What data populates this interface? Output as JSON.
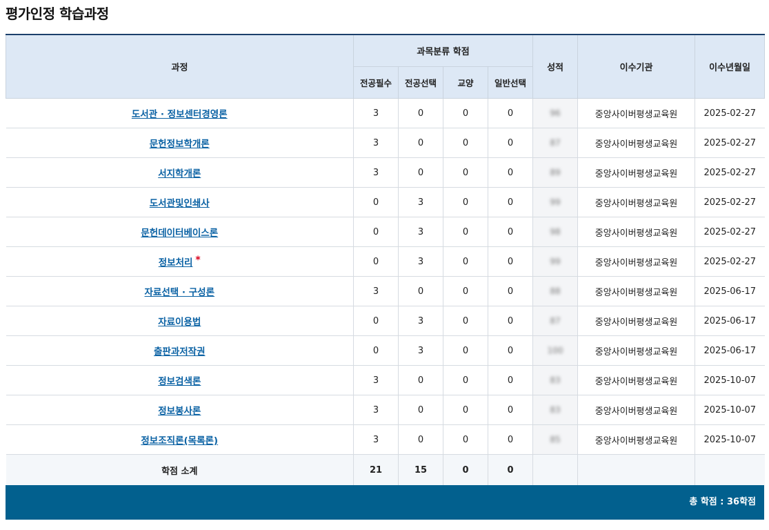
{
  "page_title": "평가인정 학습과정",
  "headers": {
    "course": "과정",
    "category_group": "과목분류 학점",
    "major_required": "전공필수",
    "major_elective": "전공선택",
    "liberal_arts": "교양",
    "general_elective": "일반선택",
    "grade": "성적",
    "institution": "이수기관",
    "completion_date": "이수년월일"
  },
  "rows": [
    {
      "course": "도서관 · 정보센터경영론",
      "mr": "3",
      "me": "0",
      "la": "0",
      "ge": "0",
      "grade": "96",
      "inst": "중앙사이버평생교육원",
      "date": "2025-02-27",
      "star": ""
    },
    {
      "course": "문헌정보학개론",
      "mr": "3",
      "me": "0",
      "la": "0",
      "ge": "0",
      "grade": "87",
      "inst": "중앙사이버평생교육원",
      "date": "2025-02-27",
      "star": ""
    },
    {
      "course": "서지학개론",
      "mr": "3",
      "me": "0",
      "la": "0",
      "ge": "0",
      "grade": "89",
      "inst": "중앙사이버평생교육원",
      "date": "2025-02-27",
      "star": ""
    },
    {
      "course": "도서관및인쇄사",
      "mr": "0",
      "me": "3",
      "la": "0",
      "ge": "0",
      "grade": "99",
      "inst": "중앙사이버평생교육원",
      "date": "2025-02-27",
      "star": ""
    },
    {
      "course": "문헌데이터베이스론",
      "mr": "0",
      "me": "3",
      "la": "0",
      "ge": "0",
      "grade": "98",
      "inst": "중앙사이버평생교육원",
      "date": "2025-02-27",
      "star": ""
    },
    {
      "course": "정보처리",
      "mr": "0",
      "me": "3",
      "la": "0",
      "ge": "0",
      "grade": "99",
      "inst": "중앙사이버평생교육원",
      "date": "2025-02-27",
      "star": "*"
    },
    {
      "course": "자료선택 · 구성론",
      "mr": "3",
      "me": "0",
      "la": "0",
      "ge": "0",
      "grade": "88",
      "inst": "중앙사이버평생교육원",
      "date": "2025-06-17",
      "star": ""
    },
    {
      "course": "자료이용법",
      "mr": "0",
      "me": "3",
      "la": "0",
      "ge": "0",
      "grade": "87",
      "inst": "중앙사이버평생교육원",
      "date": "2025-06-17",
      "star": ""
    },
    {
      "course": "출판과저작권",
      "mr": "0",
      "me": "3",
      "la": "0",
      "ge": "0",
      "grade": "100",
      "inst": "중앙사이버평생교육원",
      "date": "2025-06-17",
      "star": ""
    },
    {
      "course": "정보검색론",
      "mr": "3",
      "me": "0",
      "la": "0",
      "ge": "0",
      "grade": "83",
      "inst": "중앙사이버평생교육원",
      "date": "2025-10-07",
      "star": ""
    },
    {
      "course": "정보봉사론",
      "mr": "3",
      "me": "0",
      "la": "0",
      "ge": "0",
      "grade": "83",
      "inst": "중앙사이버평생교육원",
      "date": "2025-10-07",
      "star": ""
    },
    {
      "course": "정보조직론(목록론)",
      "mr": "3",
      "me": "0",
      "la": "0",
      "ge": "0",
      "grade": "85",
      "inst": "중앙사이버평생교육원",
      "date": "2025-10-07",
      "star": ""
    }
  ],
  "subtotal": {
    "label": "학점 소계",
    "mr": "21",
    "me": "15",
    "la": "0",
    "ge": "0"
  },
  "total": "총 학점 : 36학점"
}
